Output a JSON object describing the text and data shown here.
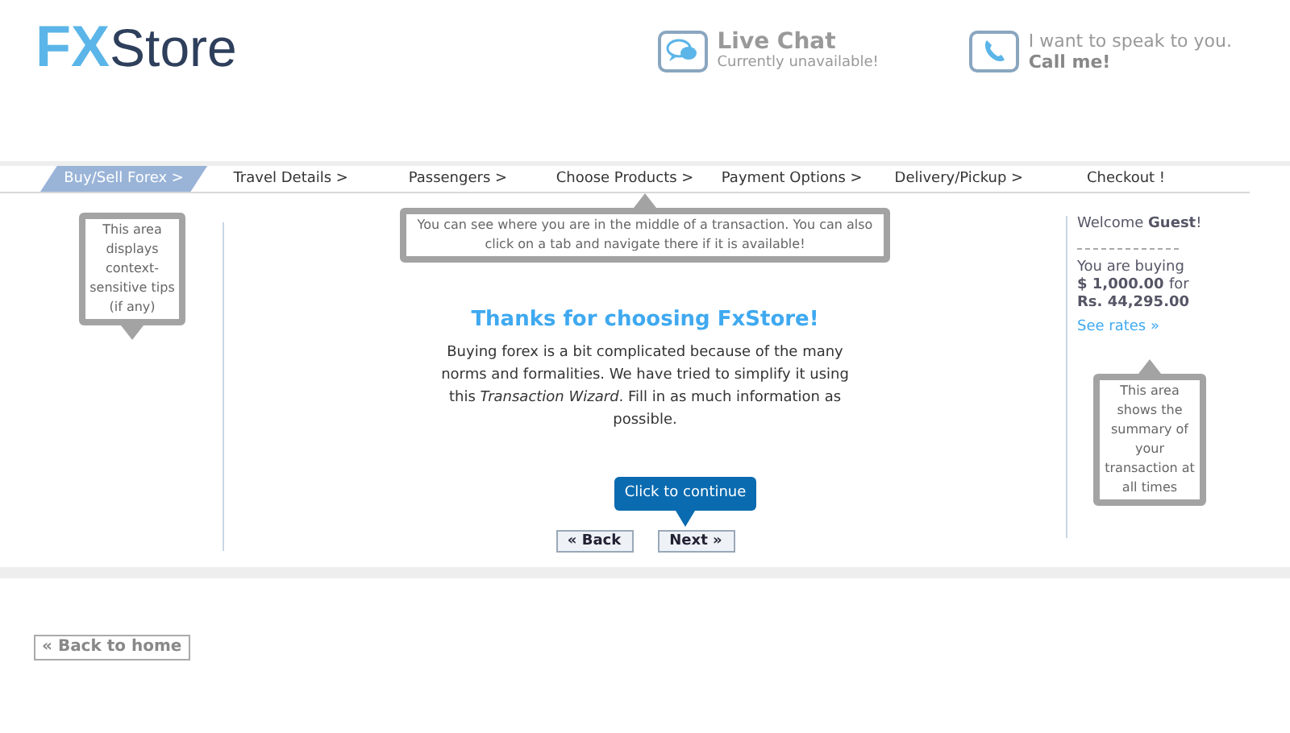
{
  "logo": {
    "mark": "FX",
    "name": "Store"
  },
  "live_chat": {
    "title": "Live Chat",
    "status": "Currently unavailable!"
  },
  "call_me": {
    "line": "I want to speak to you.",
    "action": "Call me!"
  },
  "tabs": [
    {
      "label": "Buy/Sell Forex >",
      "selected": true
    },
    {
      "label": "Travel Details >",
      "selected": false
    },
    {
      "label": "Passengers >",
      "selected": false
    },
    {
      "label": "Choose Products >",
      "selected": false
    },
    {
      "label": "Payment Options >",
      "selected": false
    },
    {
      "label": "Delivery/Pickup >",
      "selected": false
    },
    {
      "label": "Checkout !",
      "selected": false
    }
  ],
  "left_tip": "This area displays context-sensitive tips (if any)",
  "top_tip": "You can see where you are in the middle of a transaction. You can also click on a tab and navigate there if it is available!",
  "main": {
    "heading": "Thanks for choosing FxStore!",
    "text": "Buying forex is a bit complicated because of the many norms and formalities. We have tried to simplify it using this *Transaction Wizard*. Fill in as much information as possible.",
    "hint": "Click to continue",
    "back": "« Back",
    "next": "Next »"
  },
  "summary": {
    "welcome": "Welcome",
    "user": "Guest",
    "welcome_end": "!",
    "buying": "You are buying",
    "amount": "$ 1,000.00",
    "for": "for",
    "price": "Rs. 44,295.00",
    "rates_link": "See rates »",
    "tip": "This area shows the summary of your transaction at all times"
  },
  "back_home": "« Back to home"
}
